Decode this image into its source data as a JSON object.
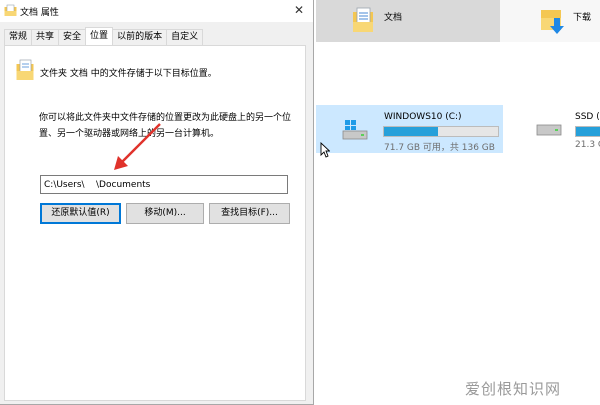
{
  "explorer": {
    "folders": [
      {
        "label": "文档",
        "icon": "document-folder-icon"
      },
      {
        "label": "下载",
        "icon": "download-folder-icon"
      }
    ],
    "drives": [
      {
        "name": "WINDOWS10 (C:)",
        "free_text": "71.7 GB 可用，共 136 GB",
        "used_fraction": 0.47,
        "icon": "windows-drive-icon"
      },
      {
        "name": "SSD (",
        "free_text": "21.3 G",
        "used_fraction": 0.9,
        "icon": "hard-drive-icon"
      }
    ],
    "bar_color": "#26a0da"
  },
  "dialog": {
    "title": "文档 属性",
    "tabs": [
      "常规",
      "共享",
      "安全",
      "位置",
      "以前的版本",
      "自定义"
    ],
    "active_tab": "位置",
    "heading": "文件夹 文档 中的文件存储于以下目标位置。",
    "description": "你可以将此文件夹中文件存储的位置更改为此硬盘上的另一个位置、另一个驱动器或网络上的另一台计算机。",
    "path_value": "C:\\Users\\    \\Documents",
    "buttons": {
      "restore": "还原默认值(R)",
      "move": "移动(M)...",
      "find": "查找目标(F)..."
    }
  },
  "watermark": "爱创根知识网",
  "accent_color": "#0078d7",
  "annotation_color": "#e0322b"
}
